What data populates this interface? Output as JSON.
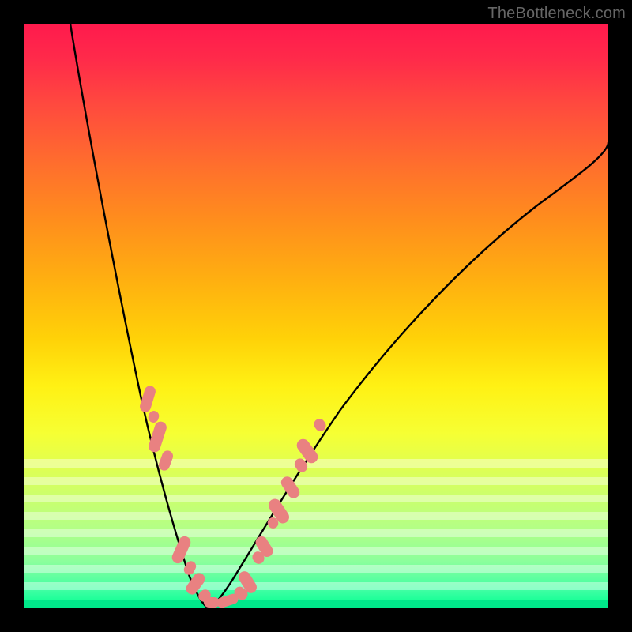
{
  "attribution": "TheBottleneck.com",
  "colors": {
    "pill": "#e98181",
    "curve": "#000000",
    "gradient_top": "#ff1a4d",
    "gradient_bottom": "#00ff8f"
  },
  "chart_data": {
    "type": "line",
    "title": "",
    "xlabel": "",
    "ylabel": "",
    "xlim": [
      0,
      100
    ],
    "ylim": [
      0,
      100
    ],
    "grid": false,
    "series": [
      {
        "name": "left-curve",
        "x": [
          8,
          10,
          12,
          14,
          16,
          18,
          20,
          22,
          23.5,
          25,
          26.5,
          28,
          29.5,
          31
        ],
        "y": [
          100,
          90,
          80,
          70,
          60,
          50,
          40,
          30,
          22,
          15,
          9,
          5,
          2,
          0
        ]
      },
      {
        "name": "right-curve",
        "x": [
          31,
          32,
          34,
          36,
          38,
          41,
          44,
          48,
          53,
          60,
          68,
          77,
          88,
          100
        ],
        "y": [
          0,
          1,
          4,
          9,
          15,
          22,
          30,
          38,
          46,
          55,
          63,
          70,
          76,
          80
        ]
      }
    ],
    "highlights": [
      {
        "name": "left-pills-upper",
        "side": "left",
        "x_range": [
          20.5,
          23.3
        ],
        "y_range": [
          20,
          38
        ]
      },
      {
        "name": "left-pills-lower",
        "side": "left",
        "x_range": [
          25.5,
          31.0
        ],
        "y_range": [
          0,
          12
        ]
      },
      {
        "name": "right-pills-lower",
        "side": "right",
        "x_range": [
          31.0,
          36.0
        ],
        "y_range": [
          0,
          10
        ]
      },
      {
        "name": "right-pills-upper",
        "side": "right",
        "x_range": [
          38.0,
          44.0
        ],
        "y_range": [
          15,
          32
        ]
      }
    ],
    "annotations": []
  }
}
